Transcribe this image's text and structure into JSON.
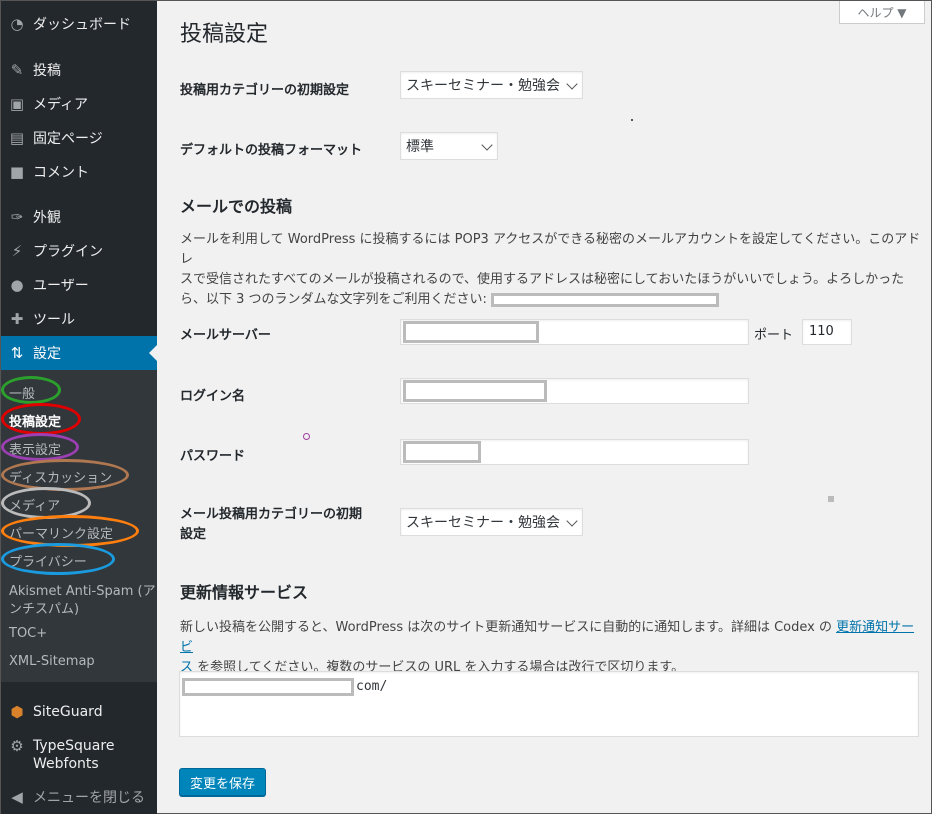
{
  "sidebar": {
    "items": [
      {
        "label": "ダッシュボード",
        "icon": "dashboard-icon"
      },
      {
        "label": "投稿",
        "icon": "pin-icon"
      },
      {
        "label": "メディア",
        "icon": "media-icon"
      },
      {
        "label": "固定ページ",
        "icon": "pages-icon"
      },
      {
        "label": "コメント",
        "icon": "comment-icon"
      },
      {
        "label": "外観",
        "icon": "brush-icon"
      },
      {
        "label": "プラグイン",
        "icon": "plugin-icon"
      },
      {
        "label": "ユーザー",
        "icon": "user-icon"
      },
      {
        "label": "ツール",
        "icon": "wrench-icon"
      },
      {
        "label": "設定",
        "icon": "settings-icon"
      },
      {
        "label": "SiteGuard",
        "icon": "shield-icon"
      },
      {
        "label": "TypeSquare",
        "icon": "gear-icon"
      },
      {
        "label": "Webfonts"
      },
      {
        "label": "メニューを閉じる",
        "icon": "collapse-icon"
      }
    ],
    "submenu": [
      {
        "label": "一般"
      },
      {
        "label": "投稿設定"
      },
      {
        "label": "表示設定"
      },
      {
        "label": "ディスカッション"
      },
      {
        "label": "メディア"
      },
      {
        "label": "パーマリンク設定"
      },
      {
        "label": "プライバシー"
      },
      {
        "label": "Akismet Anti-Spam (ア"
      },
      {
        "label": "ンチスパム)"
      },
      {
        "label": "TOC+"
      },
      {
        "label": "XML-Sitemap"
      }
    ],
    "annotation_colors": [
      "#2ca02c",
      "#e00000",
      "#9b3fb3",
      "#b07850",
      "#bbbbbb",
      "#ff7f0e",
      "#1a9be0"
    ]
  },
  "header": {
    "help": "ヘルプ ▼",
    "title": "投稿設定"
  },
  "writing": {
    "default_category_label": "投稿用カテゴリーの初期設定",
    "default_category_value": "スキーセミナー・勉強会",
    "default_format_label": "デフォルトの投稿フォーマット",
    "default_format_value": "標準"
  },
  "email": {
    "heading": "メールでの投稿",
    "description_1": "メールを利用して WordPress に投稿するには POP3 アクセスができる秘密のメールアカウントを設定してください。このアドレ",
    "description_2": "スで受信されたすべてのメールが投稿されるので、使用するアドレスは秘密にしておいたほうがいいでしょう。よろしかった",
    "description_3": "ら、以下 3 つのランダムな文字列をご利用ください: ",
    "server_label": "メールサーバー",
    "port_label": "ポート",
    "port_value": "110",
    "login_label": "ログイン名",
    "password_label": "パスワード",
    "category_label_1": "メール投稿用カテゴリーの初期",
    "category_label_2": "設定",
    "category_value": "スキーセミナー・勉強会"
  },
  "update_services": {
    "heading": "更新情報サービス",
    "description_1a": "新しい投稿を公開すると、WordPress は次のサイト更新通知サービスに自動的に通知します。詳細は Codex の ",
    "link_1": "更新通知サービ",
    "link_2": "ス",
    "description_2": "を参照してください。複数のサービスの URL を入力する場合は改行で区切ります。",
    "textarea_suffix": "com/"
  },
  "save_button": "変更を保存",
  "colors": {
    "sidebar_bg": "#23282d",
    "submenu_bg": "#32373c",
    "accent": "#0073aa",
    "button": "#0085ba"
  }
}
